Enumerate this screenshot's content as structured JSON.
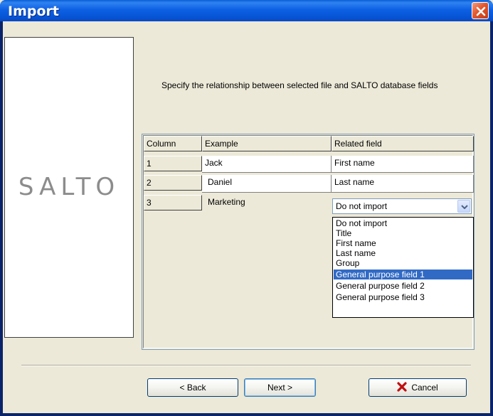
{
  "window": {
    "title": "Import",
    "close_icon": "close-icon"
  },
  "logo": {
    "text": "SALTO"
  },
  "instruction": "Specify the relationship between selected file and SALTO database fields",
  "grid": {
    "headers": [
      "Column",
      "Example",
      "Related field"
    ],
    "rows": [
      {
        "num": "1",
        "example": "Jack",
        "related": "First name"
      },
      {
        "num": "2",
        "example": "Daniel",
        "related": "Last name"
      },
      {
        "num": "3",
        "example": "Marketing",
        "related": "Do not import"
      }
    ]
  },
  "dropdown": {
    "selected_value": "Do not import",
    "options": [
      "Do not import",
      "Title",
      "First name",
      "Last name",
      "Group",
      "General purpose field 1",
      "General purpose field 2",
      "General purpose field 3"
    ],
    "highlighted": "General purpose field 1"
  },
  "buttons": {
    "back": "< Back",
    "next": "Next >",
    "cancel": "Cancel"
  },
  "colors": {
    "titlebar": "#0A5DD6",
    "selection": "#316AC5",
    "cancel_icon": "#C01010",
    "dialog_bg": "#ECE9D8"
  }
}
